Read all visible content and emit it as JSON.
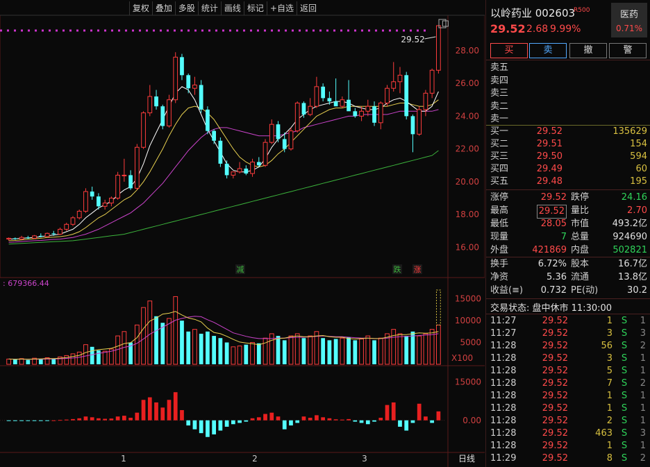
{
  "toolbar": [
    "复权",
    "叠加",
    "多股",
    "统计",
    "画线",
    "标记",
    "+自选",
    "返回"
  ],
  "chart": {
    "price_ticks": [
      "28.00",
      "26.00",
      "24.00",
      "22.00",
      "20.00",
      "18.00",
      "16.00"
    ],
    "price_min": 15.0,
    "price_max": 29.9,
    "last_price_label": "29.52",
    "signal_labels": [
      "减",
      "跌",
      "涨"
    ],
    "volume_readout": ": 679366.44",
    "volume_ticks": [
      "15000",
      "10000",
      "5000"
    ],
    "volume_unit": "X100",
    "macd_ticks": [
      "15000",
      "0.00"
    ],
    "x_labels": [
      "1",
      "2",
      "3"
    ],
    "period": "日线",
    "colors": {
      "up": "#ff3c3c",
      "down": "#54ffff",
      "ma5": "#ffffff",
      "ma10": "#e8d050",
      "ma20": "#cc44cc",
      "ma60": "#3cb43c",
      "grid": "#5a1a1a"
    }
  },
  "chart_data": {
    "type": "candlestick",
    "candles": [
      [
        16.5,
        16.6,
        16.4,
        16.55
      ],
      [
        16.55,
        16.6,
        16.45,
        16.5
      ],
      [
        16.5,
        16.7,
        16.45,
        16.6
      ],
      [
        16.6,
        16.7,
        16.5,
        16.55
      ],
      [
        16.55,
        16.75,
        16.5,
        16.7
      ],
      [
        16.7,
        16.85,
        16.6,
        16.65
      ],
      [
        16.65,
        16.9,
        16.6,
        16.85
      ],
      [
        16.85,
        17.0,
        16.7,
        16.8
      ],
      [
        16.8,
        17.2,
        16.75,
        17.1
      ],
      [
        17.1,
        17.5,
        17.0,
        17.4
      ],
      [
        17.4,
        17.9,
        17.3,
        17.8
      ],
      [
        17.8,
        18.3,
        17.7,
        18.2
      ],
      [
        18.2,
        19.6,
        18.1,
        19.4
      ],
      [
        19.4,
        19.7,
        18.9,
        19.1
      ],
      [
        19.1,
        19.3,
        18.3,
        18.5
      ],
      [
        18.5,
        18.9,
        18.3,
        18.7
      ],
      [
        18.7,
        19.1,
        18.5,
        19.0
      ],
      [
        19.0,
        20.6,
        18.9,
        20.4
      ],
      [
        20.4,
        21.4,
        20.0,
        20.4
      ],
      [
        20.4,
        20.7,
        19.5,
        19.6
      ],
      [
        19.6,
        22.3,
        19.5,
        22.1
      ],
      [
        22.1,
        24.3,
        22.0,
        24.2
      ],
      [
        24.2,
        25.9,
        24.0,
        25.2
      ],
      [
        25.2,
        25.6,
        24.4,
        24.6
      ],
      [
        24.6,
        24.7,
        23.2,
        23.4
      ],
      [
        23.4,
        25.3,
        23.3,
        25.0
      ],
      [
        25.0,
        27.9,
        24.8,
        27.6
      ],
      [
        27.6,
        27.8,
        26.2,
        26.5
      ],
      [
        26.5,
        26.6,
        25.4,
        25.7
      ],
      [
        25.7,
        26.4,
        25.3,
        25.9
      ],
      [
        25.9,
        26.2,
        24.2,
        24.4
      ],
      [
        24.4,
        24.6,
        22.9,
        23.1
      ],
      [
        23.1,
        23.2,
        22.3,
        22.5
      ],
      [
        22.5,
        22.7,
        20.9,
        21.1
      ],
      [
        21.1,
        21.3,
        20.2,
        20.4
      ],
      [
        20.4,
        20.6,
        20.2,
        20.6
      ],
      [
        20.6,
        21.2,
        20.5,
        20.8
      ],
      [
        20.8,
        21.0,
        20.4,
        20.5
      ],
      [
        20.5,
        21.4,
        20.3,
        21.2
      ],
      [
        21.2,
        21.5,
        20.9,
        21.0
      ],
      [
        21.0,
        22.6,
        20.9,
        22.4
      ],
      [
        22.4,
        23.8,
        22.3,
        23.5
      ],
      [
        23.5,
        23.7,
        22.4,
        22.6
      ],
      [
        22.6,
        23.0,
        21.8,
        22.0
      ],
      [
        22.0,
        23.3,
        21.9,
        23.1
      ],
      [
        23.1,
        24.9,
        23.0,
        24.8
      ],
      [
        24.8,
        24.9,
        23.9,
        24.1
      ],
      [
        24.1,
        25.1,
        24.0,
        24.6
      ],
      [
        24.6,
        26.4,
        24.5,
        25.8
      ],
      [
        25.8,
        26.0,
        24.9,
        25.1
      ],
      [
        25.1,
        25.5,
        24.7,
        24.9
      ],
      [
        24.9,
        26.3,
        24.8,
        24.6
      ],
      [
        24.6,
        25.2,
        24.5,
        25.0
      ],
      [
        25.0,
        26.2,
        24.8,
        24.3
      ],
      [
        24.3,
        24.5,
        23.9,
        24.0
      ],
      [
        24.0,
        24.6,
        23.7,
        24.3
      ],
      [
        24.3,
        25.0,
        24.0,
        24.6
      ],
      [
        24.6,
        24.9,
        23.4,
        23.6
      ],
      [
        23.6,
        24.9,
        23.2,
        24.8
      ],
      [
        24.8,
        25.9,
        24.6,
        25.7
      ],
      [
        25.7,
        27.3,
        25.5,
        26.1
      ],
      [
        26.1,
        27.0,
        25.4,
        26.5
      ],
      [
        26.5,
        26.7,
        23.8,
        24.0
      ],
      [
        24.0,
        24.1,
        21.8,
        22.9
      ],
      [
        22.9,
        24.6,
        22.8,
        24.4
      ],
      [
        24.4,
        25.6,
        24.0,
        25.4
      ],
      [
        25.4,
        26.9,
        25.1,
        26.8
      ],
      [
        26.8,
        29.52,
        26.6,
        29.52
      ]
    ],
    "ma5_values": [
      16.5,
      16.52,
      16.55,
      16.58,
      16.6,
      16.65,
      16.7,
      16.75,
      16.8,
      16.95,
      17.1,
      17.4,
      17.8,
      18.1,
      18.4,
      18.6,
      18.8,
      19.2,
      19.5,
      19.7,
      20.2,
      21.1,
      22.2,
      23.0,
      23.8,
      24.6,
      25.4,
      25.8,
      25.6,
      25.0,
      24.1,
      23.2,
      22.5,
      21.8,
      21.1,
      20.7,
      20.6,
      20.6,
      20.7,
      20.9,
      21.4,
      22.1,
      22.6,
      22.9,
      23.3,
      23.8,
      24.1,
      24.4,
      24.6,
      24.7,
      24.8,
      24.9,
      24.9,
      24.8,
      24.6,
      24.5,
      24.4,
      24.4,
      24.5,
      24.8,
      25.0,
      25.1,
      24.9,
      24.6,
      24.3,
      24.3,
      24.6,
      25.5
    ],
    "ma10_values": [
      16.4,
      16.42,
      16.45,
      16.5,
      16.52,
      16.55,
      16.6,
      16.62,
      16.65,
      16.7,
      16.8,
      16.95,
      17.2,
      17.5,
      17.8,
      18.0,
      18.3,
      18.6,
      18.9,
      19.1,
      19.5,
      20.0,
      20.6,
      21.3,
      22.0,
      22.8,
      23.5,
      24.1,
      24.5,
      24.6,
      24.5,
      24.2,
      23.8,
      23.2,
      22.6,
      22.0,
      21.5,
      21.2,
      21.0,
      20.9,
      21.0,
      21.3,
      21.7,
      22.0,
      22.4,
      22.8,
      23.2,
      23.6,
      24.0,
      24.2,
      24.4,
      24.5,
      24.5,
      24.6,
      24.6,
      24.6,
      24.6,
      24.6,
      24.6,
      24.6,
      24.7,
      24.8,
      24.8,
      24.7,
      24.6,
      24.6,
      24.7,
      25.0
    ],
    "ma20_values": [
      16.3,
      16.32,
      16.35,
      16.38,
      16.4,
      16.42,
      16.45,
      16.48,
      16.5,
      16.55,
      16.6,
      16.7,
      16.8,
      16.95,
      17.1,
      17.3,
      17.5,
      17.7,
      17.9,
      18.1,
      18.4,
      18.7,
      19.1,
      19.5,
      19.9,
      20.4,
      20.9,
      21.4,
      21.9,
      22.3,
      22.7,
      23.0,
      23.2,
      23.3,
      23.3,
      23.2,
      23.1,
      23.0,
      22.9,
      22.8,
      22.8,
      22.8,
      22.8,
      22.9,
      23.0,
      23.1,
      23.3,
      23.4,
      23.5,
      23.6,
      23.7,
      23.8,
      23.9,
      24.0,
      24.0,
      24.1,
      24.1,
      24.1,
      24.1,
      24.1,
      24.2,
      24.3,
      24.3,
      24.3,
      24.3,
      24.3,
      24.3,
      24.4
    ],
    "ma60_values": [
      16.2,
      16.22,
      16.24,
      16.26,
      16.28,
      16.3,
      16.32,
      16.34,
      16.36,
      16.38,
      16.4,
      16.45,
      16.5,
      16.55,
      16.6,
      16.65,
      16.7,
      16.75,
      16.8,
      16.9,
      17.0,
      17.1,
      17.2,
      17.3,
      17.4,
      17.5,
      17.6,
      17.7,
      17.8,
      17.9,
      18.0,
      18.1,
      18.2,
      18.3,
      18.4,
      18.5,
      18.6,
      18.7,
      18.8,
      18.9,
      19.0,
      19.1,
      19.2,
      19.3,
      19.4,
      19.5,
      19.6,
      19.7,
      19.8,
      19.9,
      20.0,
      20.1,
      20.2,
      20.3,
      20.4,
      20.5,
      20.6,
      20.7,
      20.8,
      20.9,
      21.0,
      21.1,
      21.2,
      21.3,
      21.4,
      21.5,
      21.6,
      21.9
    ],
    "volume": [
      1200,
      1100,
      1300,
      1000,
      1400,
      1200,
      1500,
      1300,
      1700,
      2000,
      2400,
      2800,
      4500,
      4000,
      3200,
      3000,
      3500,
      6500,
      7500,
      5000,
      9000,
      13000,
      14500,
      11000,
      9500,
      10500,
      15500,
      10000,
      7500,
      8000,
      7000,
      7500,
      6500,
      6000,
      5000,
      4000,
      4200,
      4500,
      5000,
      4800,
      6000,
      7000,
      6500,
      5500,
      6500,
      7000,
      6000,
      6500,
      7500,
      6000,
      5500,
      5800,
      6000,
      6200,
      5500,
      5800,
      6500,
      5500,
      6000,
      7000,
      8000,
      7000,
      6500,
      7500,
      6500,
      7000,
      8000,
      9000
    ],
    "volume_ylim": [
      0,
      17000
    ],
    "volume_ma5": [
      1200,
      1150,
      1200,
      1150,
      1200,
      1250,
      1300,
      1300,
      1400,
      1550,
      1800,
      2050,
      2700,
      3100,
      3350,
      3500,
      3650,
      4150,
      4750,
      4950,
      6100,
      8200,
      9900,
      10600,
      11500,
      11700,
      12100,
      11300,
      10600,
      10300,
      9700,
      8300,
      7300,
      7000,
      6400,
      5700,
      5100,
      4900,
      4700,
      4500,
      4900,
      5500,
      5900,
      6000,
      6300,
      6500,
      6300,
      6300,
      6500,
      6600,
      6300,
      6200,
      6200,
      5900,
      5800,
      5900,
      6000,
      5900,
      5900,
      6200,
      6600,
      6800,
      6800,
      7000,
      7200,
      7100,
      7200,
      7500
    ],
    "volume_ma10": [
      1200,
      1180,
      1180,
      1160,
      1170,
      1180,
      1200,
      1220,
      1270,
      1350,
      1450,
      1600,
      1900,
      2200,
      2500,
      2750,
      3000,
      3400,
      3900,
      4200,
      4800,
      5800,
      6900,
      7700,
      8500,
      9300,
      10100,
      10500,
      10800,
      11000,
      10900,
      10200,
      9600,
      8800,
      8000,
      7200,
      6800,
      6400,
      6100,
      5900,
      5900,
      5900,
      6000,
      6000,
      6100,
      6200,
      6200,
      6300,
      6400,
      6500,
      6400,
      6300,
      6300,
      6200,
      6100,
      6000,
      6000,
      5900,
      5900,
      6000,
      6200,
      6300,
      6400,
      6500,
      6600,
      6700,
      6800,
      7000
    ],
    "macd": [
      -200,
      -180,
      -150,
      -120,
      -100,
      -80,
      -50,
      0,
      150,
      300,
      500,
      800,
      1500,
      1200,
      800,
      600,
      700,
      1500,
      1800,
      1000,
      3000,
      8000,
      9000,
      7000,
      5000,
      8000,
      11000,
      4000,
      -2000,
      -3500,
      -5000,
      -6500,
      -5500,
      -4000,
      -2500,
      -1500,
      -1000,
      -500,
      800,
      1200,
      2500,
      3000,
      1500,
      -3500,
      -2000,
      -1000,
      1500,
      1000,
      2000,
      1200,
      800,
      400,
      300,
      500,
      -500,
      -1000,
      -1500,
      -500,
      1000,
      6000,
      7000,
      -2500,
      -4000,
      -1000,
      6500,
      1500,
      -1000,
      3500
    ],
    "macd_ylim": [
      -12000,
      20000
    ],
    "price_ylim": [
      15.0,
      29.9
    ]
  },
  "panel": {
    "name": "以岭药业 002603",
    "r_badge": "R500",
    "sector": "医药",
    "sector_change": "0.71%",
    "price": "29.52",
    "change": "2.68",
    "pct": "9.99%",
    "buttons": [
      "买",
      "卖",
      "撤",
      "警"
    ],
    "sells": [
      "卖五",
      "卖四",
      "卖三",
      "卖二",
      "卖一"
    ],
    "buys": [
      {
        "label": "买一",
        "price": "29.52",
        "vol": "135629"
      },
      {
        "label": "买二",
        "price": "29.51",
        "vol": "154"
      },
      {
        "label": "买三",
        "price": "29.50",
        "vol": "594"
      },
      {
        "label": "买四",
        "price": "29.49",
        "vol": "60"
      },
      {
        "label": "买五",
        "price": "29.48",
        "vol": "195"
      }
    ],
    "stats": [
      [
        {
          "k": "涨停",
          "v": "29.52",
          "c": "red"
        },
        {
          "k": "跌停",
          "v": "24.16",
          "c": "green"
        }
      ],
      [
        {
          "k": "最高",
          "v": "29.52",
          "c": "red"
        },
        {
          "k": "量比",
          "v": "2.70",
          "c": "red"
        }
      ],
      [
        {
          "k": "最低",
          "v": "28.05",
          "c": "red"
        },
        {
          "k": "市值",
          "v": "493.2亿",
          "c": "white"
        }
      ],
      [
        {
          "k": "现量",
          "v": "7",
          "c": "green"
        },
        {
          "k": "总量",
          "v": "924690",
          "c": "white"
        }
      ],
      [
        {
          "k": "外盘",
          "v": "421869",
          "c": "red"
        },
        {
          "k": "内盘",
          "v": "502821",
          "c": "green"
        }
      ]
    ],
    "stats2": [
      [
        {
          "k": "换手",
          "v": "6.72%",
          "c": "white"
        },
        {
          "k": "股本",
          "v": "16.7亿",
          "c": "white"
        }
      ],
      [
        {
          "k": "净资",
          "v": "5.36",
          "c": "white"
        },
        {
          "k": "流通",
          "v": "13.8亿",
          "c": "white"
        }
      ],
      [
        {
          "k": "收益(≡)",
          "v": "0.732",
          "c": "white"
        },
        {
          "k": "PE(动)",
          "v": "30.2",
          "c": "white"
        }
      ]
    ],
    "trade_status": "交易状态: 盘中休市 11:30:00",
    "ticks": [
      {
        "t": "11:27",
        "p": "29.52",
        "v": "1",
        "s": "S",
        "n": "1"
      },
      {
        "t": "11:27",
        "p": "29.52",
        "v": "3",
        "s": "S",
        "n": "3"
      },
      {
        "t": "11:28",
        "p": "29.52",
        "v": "56",
        "s": "S",
        "n": "2"
      },
      {
        "t": "11:28",
        "p": "29.52",
        "v": "3",
        "s": "S",
        "n": "1"
      },
      {
        "t": "11:28",
        "p": "29.52",
        "v": "5",
        "s": "S",
        "n": "1"
      },
      {
        "t": "11:28",
        "p": "29.52",
        "v": "7",
        "s": "S",
        "n": "2"
      },
      {
        "t": "11:28",
        "p": "29.52",
        "v": "1",
        "s": "S",
        "n": "1"
      },
      {
        "t": "11:28",
        "p": "29.52",
        "v": "1",
        "s": "S",
        "n": "1"
      },
      {
        "t": "11:28",
        "p": "29.52",
        "v": "2",
        "s": "S",
        "n": "1"
      },
      {
        "t": "11:28",
        "p": "29.52",
        "v": "463",
        "s": "S",
        "n": "3"
      },
      {
        "t": "11:28",
        "p": "29.52",
        "v": "1",
        "s": "S",
        "n": "1"
      },
      {
        "t": "11:29",
        "p": "29.52",
        "v": "8",
        "s": "S",
        "n": "2"
      }
    ]
  }
}
